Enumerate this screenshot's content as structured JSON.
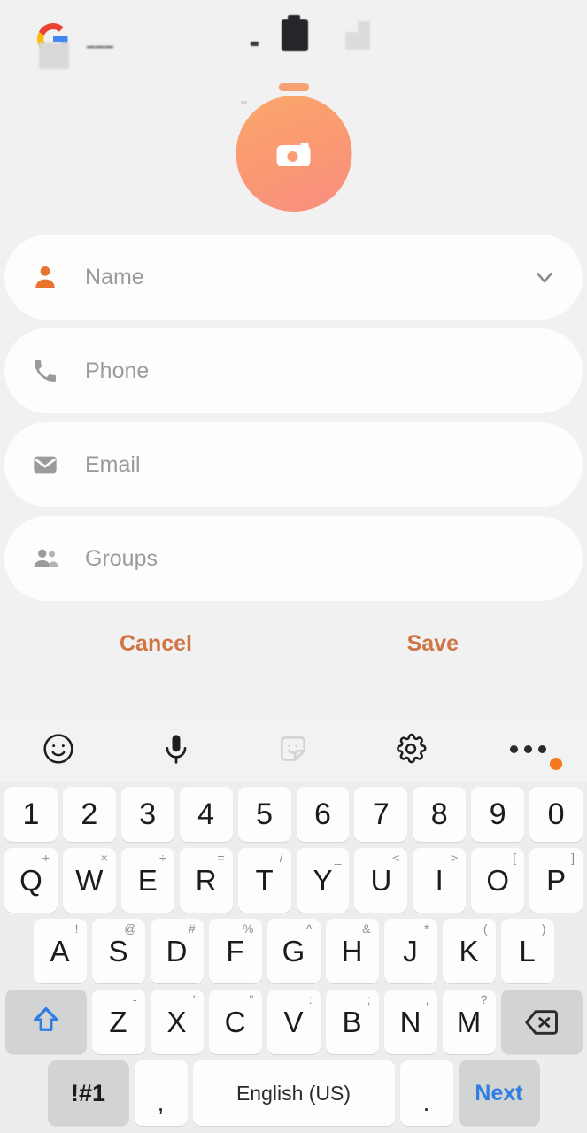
{
  "statusbar": {
    "google_logo": "google-logo",
    "battery_icon": "battery-icon",
    "signal_icon": "signal-bars-icon"
  },
  "avatar": {
    "icon": "camera-icon",
    "gradient_start": "#fba86b",
    "gradient_end": "#f88e80"
  },
  "form": {
    "fields": [
      {
        "icon": "person-icon",
        "placeholder": "Name",
        "value": "",
        "icon_color": "#e8722e",
        "has_chevron": true,
        "chevron_icon": "chevron-down-icon"
      },
      {
        "icon": "phone-icon",
        "placeholder": "Phone",
        "value": "",
        "icon_color": "#9b9b9b",
        "has_chevron": false,
        "chevron_icon": ""
      },
      {
        "icon": "email-icon",
        "placeholder": "Email",
        "value": "",
        "icon_color": "#9b9b9b",
        "has_chevron": false,
        "chevron_icon": ""
      },
      {
        "icon": "groups-icon",
        "placeholder": "Groups",
        "value": "",
        "icon_color": "#9b9b9b",
        "has_chevron": false,
        "chevron_icon": ""
      }
    ],
    "cancel_label": "Cancel",
    "save_label": "Save",
    "accent_color": "#cf7545"
  },
  "keyboard": {
    "toolbar": [
      {
        "icon": "emoji-icon",
        "badge": false
      },
      {
        "icon": "microphone-icon",
        "badge": false
      },
      {
        "icon": "sticker-icon",
        "badge": false
      },
      {
        "icon": "settings-gear-icon",
        "badge": false
      },
      {
        "icon": "more-options-icon",
        "badge": true,
        "badge_color": "#f4791f"
      }
    ],
    "row_numbers": [
      {
        "label": "1"
      },
      {
        "label": "2"
      },
      {
        "label": "3"
      },
      {
        "label": "4"
      },
      {
        "label": "5"
      },
      {
        "label": "6"
      },
      {
        "label": "7"
      },
      {
        "label": "8"
      },
      {
        "label": "9"
      },
      {
        "label": "0"
      }
    ],
    "row_q": [
      {
        "label": "Q",
        "sup": "+"
      },
      {
        "label": "W",
        "sup": "×"
      },
      {
        "label": "E",
        "sup": "÷"
      },
      {
        "label": "R",
        "sup": "="
      },
      {
        "label": "T",
        "sup": "/"
      },
      {
        "label": "Y",
        "sup": "_"
      },
      {
        "label": "U",
        "sup": "<"
      },
      {
        "label": "I",
        "sup": ">"
      },
      {
        "label": "O",
        "sup": "["
      },
      {
        "label": "P",
        "sup": "]"
      }
    ],
    "row_a": [
      {
        "label": "A",
        "sup": "!"
      },
      {
        "label": "S",
        "sup": "@"
      },
      {
        "label": "D",
        "sup": "#"
      },
      {
        "label": "F",
        "sup": "%"
      },
      {
        "label": "G",
        "sup": "^"
      },
      {
        "label": "H",
        "sup": "&"
      },
      {
        "label": "J",
        "sup": "*"
      },
      {
        "label": "K",
        "sup": "("
      },
      {
        "label": "L",
        "sup": ")"
      }
    ],
    "row_z": [
      {
        "label": "Z",
        "sup": "-"
      },
      {
        "label": "X",
        "sup": "'"
      },
      {
        "label": "C",
        "sup": "\""
      },
      {
        "label": "V",
        "sup": ":"
      },
      {
        "label": "B",
        "sup": ";"
      },
      {
        "label": "N",
        "sup": ","
      },
      {
        "label": "M",
        "sup": "?"
      }
    ],
    "shift_icon": "shift-icon",
    "shift_color": "#2f7de1",
    "backspace_icon": "backspace-icon",
    "symbols_label": "!#1",
    "comma_label": ",",
    "space_label": "English (US)",
    "period_label": ".",
    "next_label": "Next",
    "next_color": "#2f7de1"
  }
}
